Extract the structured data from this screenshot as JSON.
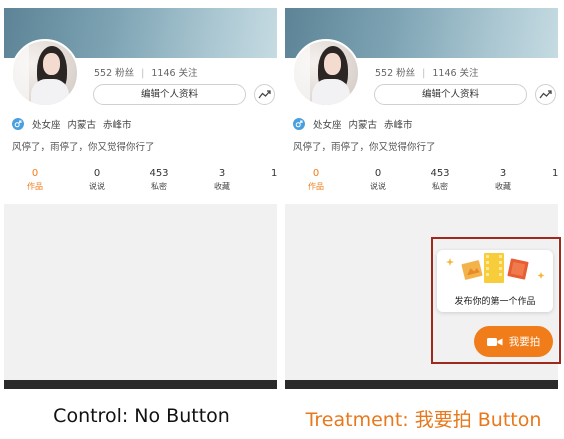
{
  "profile": {
    "stats": {
      "fans": "552 粉丝",
      "follow": "1146 关注",
      "separator": "|"
    },
    "edit_button": "编辑个人资料",
    "info_tags": [
      "处女座",
      "内蒙古",
      "赤峰市"
    ],
    "bio": "风停了，雨停了，你又觉得你行了",
    "tabs": [
      {
        "num": "0",
        "label": "作品",
        "active": true
      },
      {
        "num": "0",
        "label": "说说",
        "active": false
      },
      {
        "num": "453",
        "label": "私密",
        "active": false
      },
      {
        "num": "3",
        "label": "收藏",
        "active": false
      },
      {
        "num": "1",
        "label": "",
        "active": false
      }
    ]
  },
  "treatment": {
    "bubble_caption": "发布你的第一个作品",
    "shoot_button": "我要拍",
    "highlight_color": "#9d2a1c",
    "accent": "#f07d1a"
  },
  "captions": {
    "control": "Control: No Button",
    "treatment": "Treatment: 我要拍 Button"
  },
  "icons": {
    "gender": "male-icon",
    "trend": "trend-arrow-icon",
    "camera": "video-camera-icon"
  }
}
